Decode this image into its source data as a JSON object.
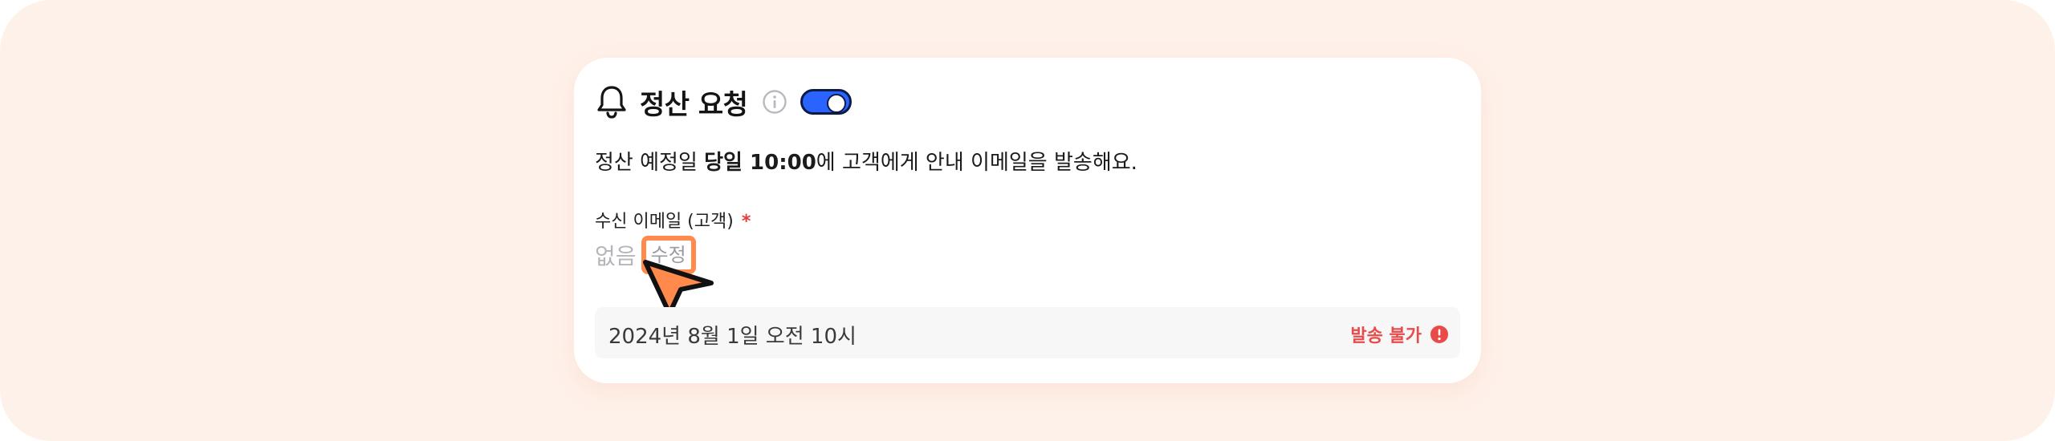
{
  "header": {
    "title": "정산 요청",
    "toggle_on": true,
    "toggle_color": "#2b63ff"
  },
  "description": {
    "prefix": "정산 예정일 ",
    "highlight": "당일 10:00",
    "suffix": "에 고객에게 안내 이메일을 발송해요."
  },
  "recipient": {
    "label": "수신 이메일 (고객)",
    "required_mark": "*",
    "value": "없음",
    "edit_label": "수정",
    "highlight_color": "#ff8a4c"
  },
  "schedule": {
    "datetime": "2024년 8월 1일 오전 10시",
    "status": "발송 불가",
    "status_color": "#e94b4b"
  },
  "icons": {
    "bell": "bell-icon",
    "info": "info-icon",
    "alert": "alert-circle-icon",
    "cursor": "mouse-pointer-icon"
  }
}
